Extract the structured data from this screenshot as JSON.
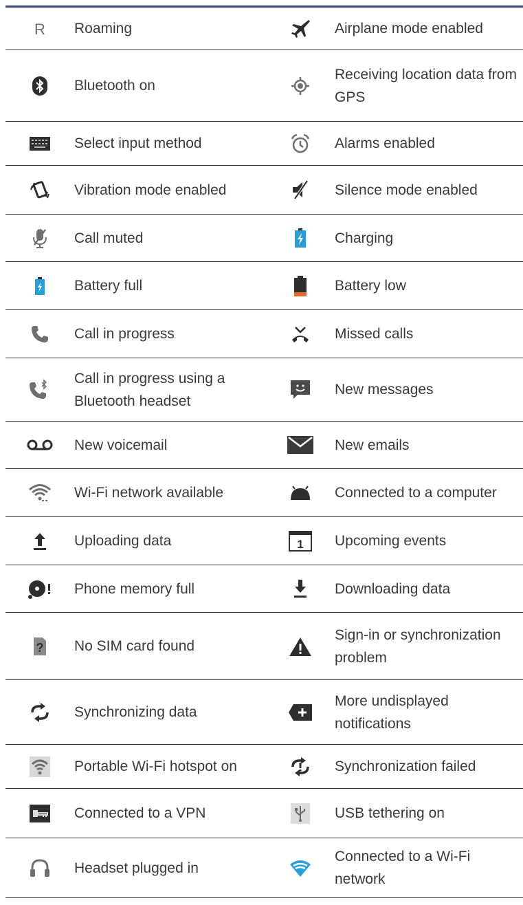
{
  "rows": [
    {
      "left": {
        "icon": "roaming-icon",
        "glyph": "R",
        "label": "Roaming"
      },
      "right": {
        "icon": "airplane-icon",
        "label": "Airplane mode enabled"
      }
    },
    {
      "left": {
        "icon": "bluetooth-icon",
        "label": "Bluetooth on"
      },
      "right": {
        "icon": "gps-icon",
        "label": "Receiving location data from GPS"
      }
    },
    {
      "left": {
        "icon": "keyboard-icon",
        "label": "Select input method"
      },
      "right": {
        "icon": "alarm-icon",
        "label": "Alarms enabled"
      }
    },
    {
      "left": {
        "icon": "vibrate-icon",
        "label": "Vibration mode enabled"
      },
      "right": {
        "icon": "silent-icon",
        "label": "Silence mode enabled"
      }
    },
    {
      "left": {
        "icon": "mic-muted-icon",
        "label": "Call muted"
      },
      "right": {
        "icon": "charging-icon",
        "label": "Charging"
      }
    },
    {
      "left": {
        "icon": "battery-full-icon",
        "label": "Battery full"
      },
      "right": {
        "icon": "battery-low-icon",
        "label": "Battery low"
      }
    },
    {
      "left": {
        "icon": "phone-icon",
        "label": "Call in progress"
      },
      "right": {
        "icon": "missed-call-icon",
        "label": "Missed calls"
      }
    },
    {
      "left": {
        "icon": "phone-bluetooth-icon",
        "label": "Call in progress using a Bluetooth headset"
      },
      "right": {
        "icon": "message-icon",
        "label": "New messages"
      }
    },
    {
      "left": {
        "icon": "voicemail-icon",
        "label": "New voicemail"
      },
      "right": {
        "icon": "email-icon",
        "label": "New emails"
      }
    },
    {
      "left": {
        "icon": "wifi-available-icon",
        "label": "Wi-Fi network available"
      },
      "right": {
        "icon": "android-usb-icon",
        "label": "Connected to a computer"
      }
    },
    {
      "left": {
        "icon": "upload-icon",
        "label": "Uploading data"
      },
      "right": {
        "icon": "calendar-icon",
        "glyph": "1",
        "label": "Upcoming events"
      }
    },
    {
      "left": {
        "icon": "memory-full-icon",
        "label": "Phone memory full"
      },
      "right": {
        "icon": "download-icon",
        "label": "Downloading data"
      }
    },
    {
      "left": {
        "icon": "no-sim-icon",
        "glyph": "?",
        "label": "No SIM card found"
      },
      "right": {
        "icon": "warning-icon",
        "label": "Sign-in or synchronization problem"
      }
    },
    {
      "left": {
        "icon": "sync-icon",
        "label": "Synchronizing data"
      },
      "right": {
        "icon": "more-notifications-icon",
        "label": "More undisplayed notifications"
      }
    },
    {
      "left": {
        "icon": "hotspot-icon",
        "label": "Portable Wi-Fi hotspot on"
      },
      "right": {
        "icon": "sync-failed-icon",
        "label": "Synchronization failed"
      }
    },
    {
      "left": {
        "icon": "vpn-icon",
        "label": "Connected to a VPN"
      },
      "right": {
        "icon": "usb-icon",
        "label": "USB tethering on"
      }
    },
    {
      "left": {
        "icon": "headset-icon",
        "label": "Headset plugged in"
      },
      "right": {
        "icon": "wifi-connected-icon",
        "label": "Connected to a Wi-Fi network"
      }
    }
  ],
  "colors": {
    "rule": "#333333",
    "top_rule": "#2f4a7a",
    "icon_gray": "#6f6f6f",
    "icon_dark": "#2e2e2e",
    "battery_blue": "#2a9fd6",
    "battery_orange": "#e8682a",
    "wifi_blue": "#2a9fd6"
  }
}
